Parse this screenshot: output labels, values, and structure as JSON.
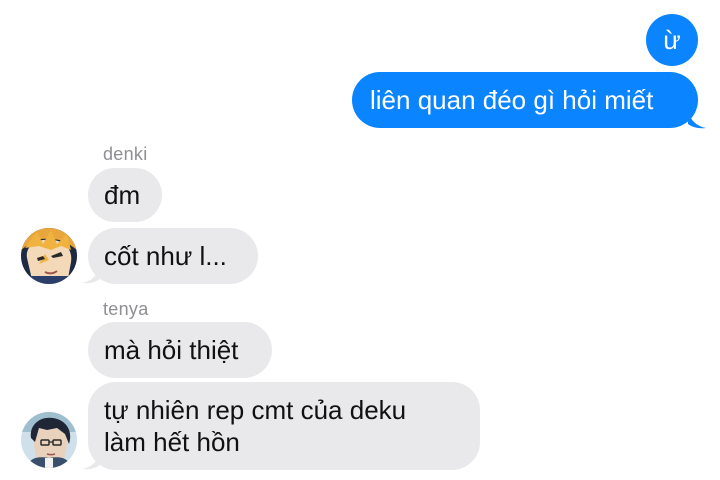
{
  "conversation": {
    "outgoing": [
      {
        "text": "ừ"
      },
      {
        "text": "liên quan đéo gì hỏi miết"
      }
    ],
    "groups": [
      {
        "sender": "denki",
        "messages": [
          {
            "text": "đm"
          },
          {
            "text": "cốt như l..."
          }
        ]
      },
      {
        "sender": "tenya",
        "messages": [
          {
            "text": "mà hỏi thiệt"
          },
          {
            "lines": [
              "tự nhiên rep cmt của deku",
              "làm hết hồn"
            ]
          }
        ]
      }
    ]
  },
  "colors": {
    "outgoing_bubble": "#0a84ff",
    "incoming_bubble": "#e9e9eb",
    "sender_label": "#8e8e93"
  },
  "icons": {
    "denki_avatar": "avatar-blond-character",
    "tenya_avatar": "avatar-dark-haired-character"
  }
}
